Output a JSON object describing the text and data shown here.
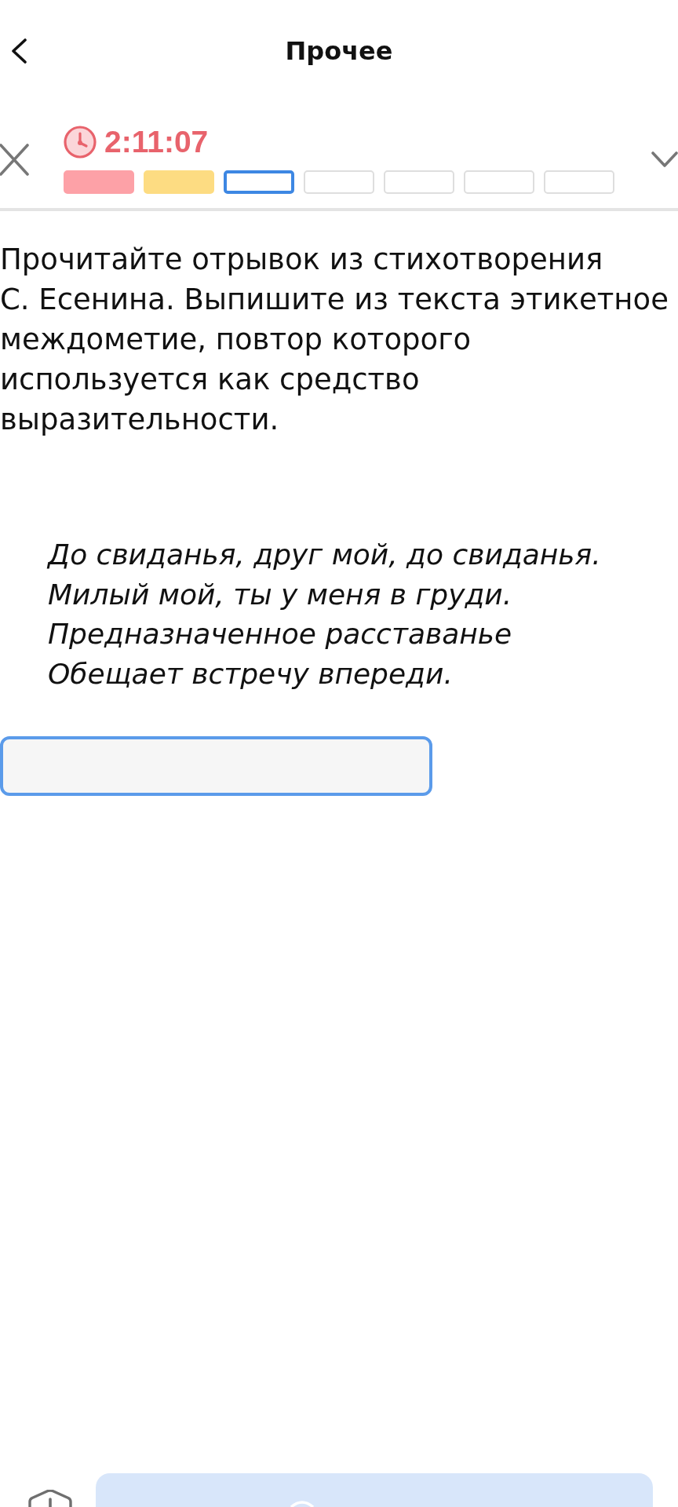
{
  "header": {
    "title": "Прочее"
  },
  "quiz_bar": {
    "timer": "2:11:07",
    "questions": [
      {
        "kind": "incorrect",
        "selected": false
      },
      {
        "kind": "partial",
        "selected": false
      },
      {
        "kind": "unanswered",
        "selected": true
      },
      {
        "kind": "unanswered",
        "selected": false
      },
      {
        "kind": "unanswered",
        "selected": false
      },
      {
        "kind": "unanswered",
        "selected": false
      },
      {
        "kind": "unanswered",
        "selected": false
      }
    ]
  },
  "task": {
    "prompt": "Прочитайте отрывок из стихотворения С. Есенина. Выпишите из текста этикетное междометие, повтор которого используется как средство выразительности.",
    "poem": [
      "До свиданья, друг мой, до свиданья.",
      "Милый мой, ты у меня в груди.",
      "Предназначенное расставанье",
      "Обещает встречу впереди."
    ]
  },
  "answer_field": {
    "focused": true
  }
}
